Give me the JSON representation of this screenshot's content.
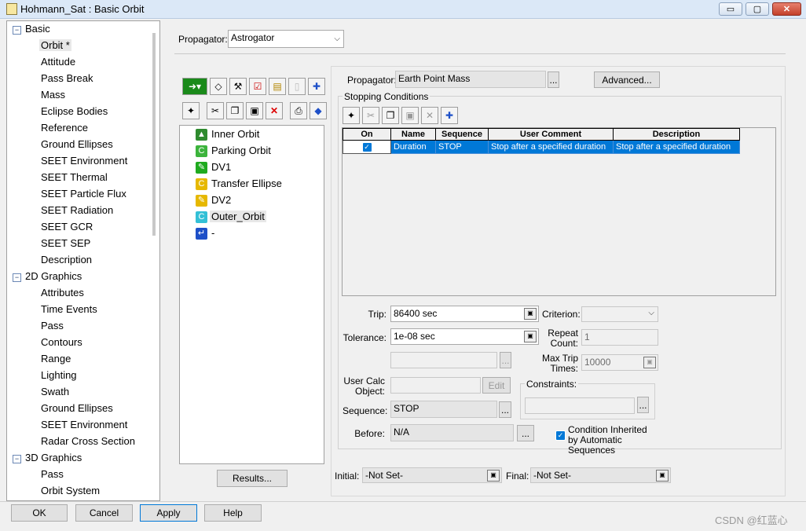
{
  "window": {
    "title": "Hohmann_Sat : Basic Orbit",
    "minimize": "▭",
    "maximize": "▢",
    "close": "✕"
  },
  "tree": [
    {
      "label": "Basic",
      "level": 0,
      "expanded": true
    },
    {
      "label": "Orbit *",
      "level": 1,
      "selected": true
    },
    {
      "label": "Attitude",
      "level": 1
    },
    {
      "label": "Pass Break",
      "level": 1
    },
    {
      "label": "Mass",
      "level": 1
    },
    {
      "label": "Eclipse Bodies",
      "level": 1
    },
    {
      "label": "Reference",
      "level": 1
    },
    {
      "label": "Ground Ellipses",
      "level": 1
    },
    {
      "label": "SEET Environment",
      "level": 1
    },
    {
      "label": "SEET Thermal",
      "level": 1
    },
    {
      "label": "SEET Particle Flux",
      "level": 1
    },
    {
      "label": "SEET Radiation",
      "level": 1
    },
    {
      "label": "SEET GCR",
      "level": 1
    },
    {
      "label": "SEET SEP",
      "level": 1
    },
    {
      "label": "Description",
      "level": 1
    },
    {
      "label": "2D Graphics",
      "level": 0,
      "expanded": true
    },
    {
      "label": "Attributes",
      "level": 1
    },
    {
      "label": "Time Events",
      "level": 1
    },
    {
      "label": "Pass",
      "level": 1
    },
    {
      "label": "Contours",
      "level": 1
    },
    {
      "label": "Range",
      "level": 1
    },
    {
      "label": "Lighting",
      "level": 1
    },
    {
      "label": "Swath",
      "level": 1
    },
    {
      "label": "Ground Ellipses",
      "level": 1
    },
    {
      "label": "SEET Environment",
      "level": 1
    },
    {
      "label": "Radar Cross Section",
      "level": 1
    },
    {
      "label": "3D Graphics",
      "level": 0,
      "expanded": true
    },
    {
      "label": "Pass",
      "level": 1
    },
    {
      "label": "Orbit System",
      "level": 1
    }
  ],
  "propagator_top": {
    "label": "Propagator:",
    "value": "Astrogator"
  },
  "sequence": {
    "items": [
      {
        "label": "Inner Orbit",
        "icon": "initial-state-icon",
        "color": "#2e8b2e"
      },
      {
        "label": "Parking Orbit",
        "icon": "propagate-icon",
        "color": "#3cb43c"
      },
      {
        "label": "DV1",
        "icon": "maneuver-icon",
        "color": "#1faa1f"
      },
      {
        "label": "Transfer Ellipse",
        "icon": "propagate-icon",
        "color": "#e6b800"
      },
      {
        "label": "DV2",
        "icon": "maneuver-icon",
        "color": "#e6b800"
      },
      {
        "label": "Outer_Orbit",
        "icon": "propagate-icon",
        "color": "#33c0d6",
        "selected": true
      },
      {
        "label": "-",
        "icon": "return-arrow-icon",
        "color": "#1e50c8"
      }
    ],
    "results_button": "Results..."
  },
  "segment": {
    "propagator_label": "Propagator:",
    "propagator_value": "Earth Point Mass",
    "browse": "...",
    "advanced_button": "Advanced...",
    "stopping_conditions_label": "Stopping Conditions",
    "table": {
      "headers": [
        "On",
        "Name",
        "Sequence",
        "User Comment",
        "Description"
      ],
      "rows": [
        {
          "on": true,
          "name": "Duration",
          "sequence": "STOP",
          "user_comment": "Stop after a specified duration",
          "description": "Stop after a specified duration"
        }
      ]
    },
    "trip_label": "Trip:",
    "trip_value": "86400 sec",
    "tolerance_label": "Tolerance:",
    "tolerance_value": "1e-08 sec",
    "criterion_label": "Criterion:",
    "criterion_value": "",
    "repeat_count_label": "Repeat Count:",
    "repeat_count_value": "1",
    "max_trip_label": "Max Trip Times:",
    "max_trip_value": "10000",
    "user_calc_label": "User Calc Object:",
    "user_calc_value": "",
    "edit_button": "Edit",
    "constraints_label": "Constraints:",
    "sequence_label": "Sequence:",
    "sequence_value": "STOP",
    "before_label": "Before:",
    "before_value": "N/A",
    "inherited_label": "Condition Inherited by Automatic Sequences",
    "initial_label": "Initial:",
    "initial_value": "-Not Set-",
    "final_label": "Final:",
    "final_value": "-Not Set-"
  },
  "footer": {
    "ok": "OK",
    "cancel": "Cancel",
    "apply": "Apply",
    "help": "Help",
    "watermark": "CSDN @红蓝心"
  }
}
